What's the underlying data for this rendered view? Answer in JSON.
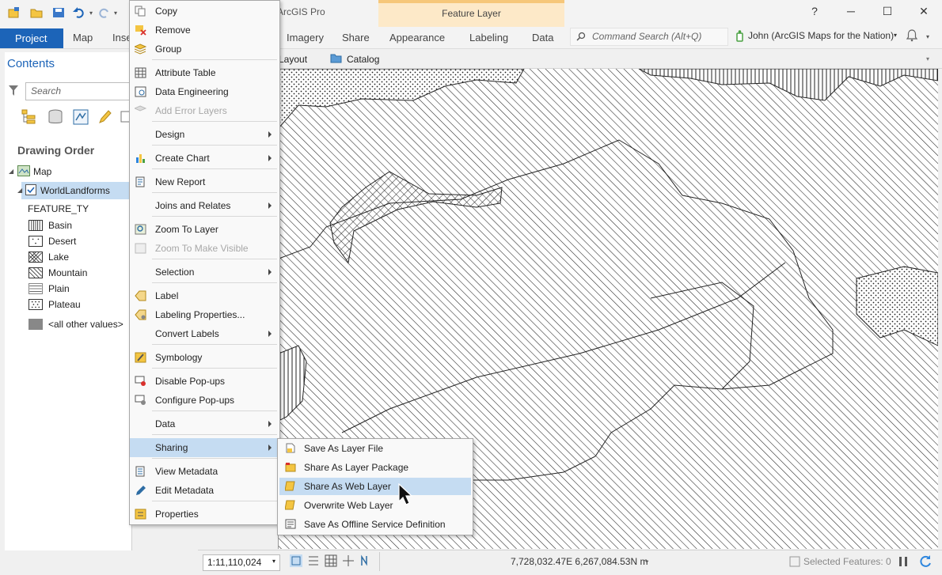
{
  "app": {
    "title": "ArcGIS Pro",
    "contextual_tab_group": "Feature Layer",
    "window_buttons": {
      "help": "?",
      "minimize": "─",
      "maximize": "☐",
      "close": "✕"
    }
  },
  "ribbon": {
    "project_tab": "Project",
    "tabs": [
      "Map",
      "Inse",
      "Imagery",
      "Share",
      "Appearance",
      "Labeling",
      "Data"
    ],
    "command_search_placeholder": "Command Search (Alt+Q)",
    "user": "John (ArcGIS Maps for the Nation)"
  },
  "view_tabs": {
    "layout": "Layout",
    "catalog": "Catalog"
  },
  "contents": {
    "title": "Contents",
    "search_placeholder": "Search",
    "drawing_order": "Drawing Order",
    "map_node": "Map",
    "layer": "WorldLandforms",
    "field": "FEATURE_TY",
    "legend": [
      "Basin",
      "Desert",
      "Lake",
      "Mountain",
      "Plain",
      "Plateau",
      "<all other values>"
    ]
  },
  "context_menu": {
    "items": [
      {
        "label": "Copy"
      },
      {
        "label": "Remove"
      },
      {
        "label": "Group"
      },
      {
        "label": "Attribute Table"
      },
      {
        "label": "Data Engineering"
      },
      {
        "label": "Add Error Layers"
      },
      {
        "label": "Design"
      },
      {
        "label": "Create Chart"
      },
      {
        "label": "New Report"
      },
      {
        "label": "Joins and Relates"
      },
      {
        "label": "Zoom To Layer"
      },
      {
        "label": "Zoom To Make Visible"
      },
      {
        "label": "Selection"
      },
      {
        "label": "Label"
      },
      {
        "label": "Labeling Properties..."
      },
      {
        "label": "Convert Labels"
      },
      {
        "label": "Symbology"
      },
      {
        "label": "Disable Pop-ups"
      },
      {
        "label": "Configure Pop-ups"
      },
      {
        "label": "Data"
      },
      {
        "label": "Sharing"
      },
      {
        "label": "View Metadata"
      },
      {
        "label": "Edit Metadata"
      },
      {
        "label": "Properties"
      }
    ]
  },
  "sharing_submenu": {
    "items": [
      {
        "label": "Save As Layer File"
      },
      {
        "label": "Share As Layer Package"
      },
      {
        "label": "Share As Web Layer"
      },
      {
        "label": "Overwrite Web Layer"
      },
      {
        "label": "Save As Offline Service Definition"
      }
    ]
  },
  "status_bar": {
    "scale": "1:11,110,024",
    "coordinates": "7,728,032.47E 6,267,084.53N m",
    "selected_features": "Selected Features: 0"
  }
}
